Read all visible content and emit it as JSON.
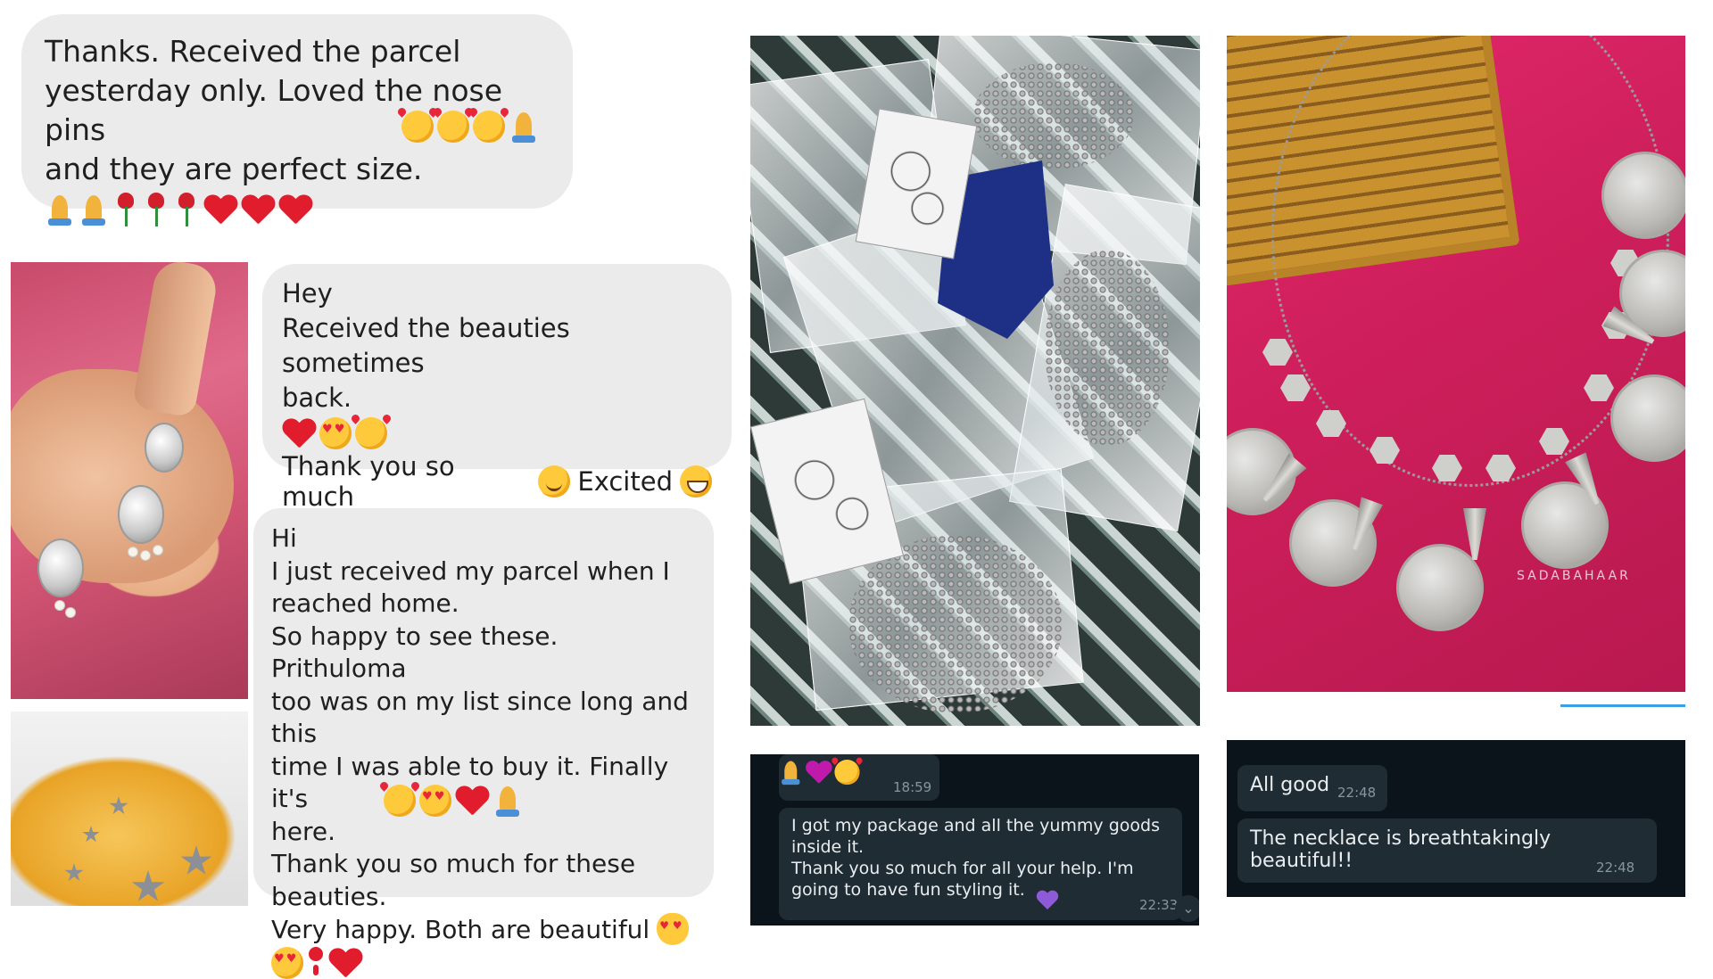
{
  "bubbles": {
    "b1": {
      "text": "Thanks. Received the parcel\nyesterday only. Loved the nose pins\nand they are perfect size."
    },
    "b2": {
      "text": "Hey\nReceived the beauties sometimes\nback.",
      "line2": "Thank you so much",
      "line2b": "Excited"
    },
    "b3": {
      "text": "Hi\nI just received my parcel when I\nreached home.\nSo happy to see these. Prithuloma\ntoo was on my list since long and this\ntime I was able to buy it. Finally it's\nhere.\nThank you so much for these\nbeauties.",
      "line2": "Very happy. Both are beautiful"
    }
  },
  "dark1": {
    "top_time": "18:59",
    "message": "I got my package and all the yummy goods\ninside it.\nThank you so much for all your help. I'm\ngoing to have fun styling it.",
    "time": "22:33",
    "scroll_icon": "chevron-down-icon"
  },
  "dark2": {
    "msg1": "All good",
    "time1": "22:48",
    "msg2": "The necklace is breathtakingly beautiful!!",
    "time2": "22:48"
  },
  "photos": {
    "necklace_watermark": "SADABAHAAR"
  },
  "colors": {
    "light_bubble": "#ebebeb",
    "dark_bg": "#0b141a",
    "dark_bubble": "#1f2c34",
    "heart_red": "#e11d2d"
  }
}
